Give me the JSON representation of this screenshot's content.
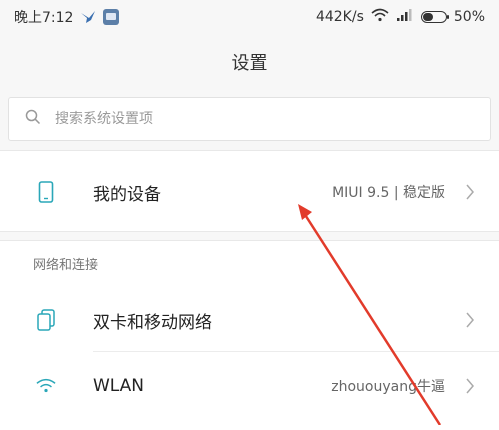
{
  "status_bar": {
    "time": "晚上7:12",
    "speed": "442K/s",
    "battery_percent": "50%",
    "battery_level": 0.5,
    "icons": [
      "bird-icon",
      "app-icon",
      "wifi-icon",
      "signal-icon",
      "battery-icon"
    ]
  },
  "header": {
    "title": "设置"
  },
  "search": {
    "placeholder": "搜索系统设置项",
    "value": ""
  },
  "device": {
    "title": "我的设备",
    "value": "MIUI 9.5 | 稳定版",
    "icon": "phone-icon"
  },
  "network_section": {
    "label": "网络和连接",
    "items": [
      {
        "title": "双卡和移动网络",
        "value": "",
        "icon": "sim-icon"
      },
      {
        "title": "WLAN",
        "value": "zhououyang牛逼",
        "icon": "wifi-icon"
      }
    ]
  },
  "colors": {
    "accent": "#2aa7b8",
    "annotation_arrow": "#e23b2b"
  }
}
